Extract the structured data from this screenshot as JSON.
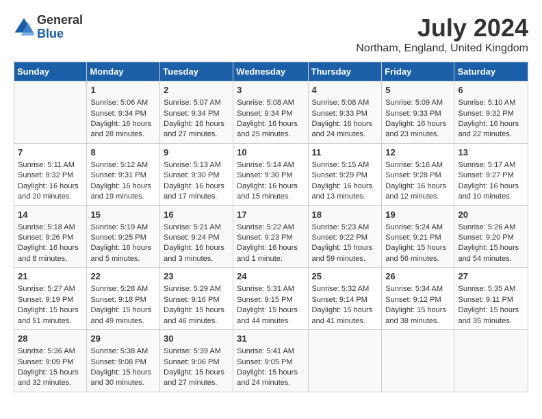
{
  "header": {
    "logo_general": "General",
    "logo_blue": "Blue",
    "month_year": "July 2024",
    "location": "Northam, England, United Kingdom"
  },
  "days_of_week": [
    "Sunday",
    "Monday",
    "Tuesday",
    "Wednesday",
    "Thursday",
    "Friday",
    "Saturday"
  ],
  "weeks": [
    [
      {
        "day": "",
        "info": ""
      },
      {
        "day": "1",
        "info": "Sunrise: 5:06 AM\nSunset: 9:34 PM\nDaylight: 16 hours\nand 28 minutes."
      },
      {
        "day": "2",
        "info": "Sunrise: 5:07 AM\nSunset: 9:34 PM\nDaylight: 16 hours\nand 27 minutes."
      },
      {
        "day": "3",
        "info": "Sunrise: 5:08 AM\nSunset: 9:34 PM\nDaylight: 16 hours\nand 25 minutes."
      },
      {
        "day": "4",
        "info": "Sunrise: 5:08 AM\nSunset: 9:33 PM\nDaylight: 16 hours\nand 24 minutes."
      },
      {
        "day": "5",
        "info": "Sunrise: 5:09 AM\nSunset: 9:33 PM\nDaylight: 16 hours\nand 23 minutes."
      },
      {
        "day": "6",
        "info": "Sunrise: 5:10 AM\nSunset: 9:32 PM\nDaylight: 16 hours\nand 22 minutes."
      }
    ],
    [
      {
        "day": "7",
        "info": "Sunrise: 5:11 AM\nSunset: 9:32 PM\nDaylight: 16 hours\nand 20 minutes."
      },
      {
        "day": "8",
        "info": "Sunrise: 5:12 AM\nSunset: 9:31 PM\nDaylight: 16 hours\nand 19 minutes."
      },
      {
        "day": "9",
        "info": "Sunrise: 5:13 AM\nSunset: 9:30 PM\nDaylight: 16 hours\nand 17 minutes."
      },
      {
        "day": "10",
        "info": "Sunrise: 5:14 AM\nSunset: 9:30 PM\nDaylight: 16 hours\nand 15 minutes."
      },
      {
        "day": "11",
        "info": "Sunrise: 5:15 AM\nSunset: 9:29 PM\nDaylight: 16 hours\nand 13 minutes."
      },
      {
        "day": "12",
        "info": "Sunrise: 5:16 AM\nSunset: 9:28 PM\nDaylight: 16 hours\nand 12 minutes."
      },
      {
        "day": "13",
        "info": "Sunrise: 5:17 AM\nSunset: 9:27 PM\nDaylight: 16 hours\nand 10 minutes."
      }
    ],
    [
      {
        "day": "14",
        "info": "Sunrise: 5:18 AM\nSunset: 9:26 PM\nDaylight: 16 hours\nand 8 minutes."
      },
      {
        "day": "15",
        "info": "Sunrise: 5:19 AM\nSunset: 9:25 PM\nDaylight: 16 hours\nand 5 minutes."
      },
      {
        "day": "16",
        "info": "Sunrise: 5:21 AM\nSunset: 9:24 PM\nDaylight: 16 hours\nand 3 minutes."
      },
      {
        "day": "17",
        "info": "Sunrise: 5:22 AM\nSunset: 9:23 PM\nDaylight: 16 hours\nand 1 minute."
      },
      {
        "day": "18",
        "info": "Sunrise: 5:23 AM\nSunset: 9:22 PM\nDaylight: 15 hours\nand 59 minutes."
      },
      {
        "day": "19",
        "info": "Sunrise: 5:24 AM\nSunset: 9:21 PM\nDaylight: 15 hours\nand 56 minutes."
      },
      {
        "day": "20",
        "info": "Sunrise: 5:26 AM\nSunset: 9:20 PM\nDaylight: 15 hours\nand 54 minutes."
      }
    ],
    [
      {
        "day": "21",
        "info": "Sunrise: 5:27 AM\nSunset: 9:19 PM\nDaylight: 15 hours\nand 51 minutes."
      },
      {
        "day": "22",
        "info": "Sunrise: 5:28 AM\nSunset: 9:18 PM\nDaylight: 15 hours\nand 49 minutes."
      },
      {
        "day": "23",
        "info": "Sunrise: 5:29 AM\nSunset: 9:16 PM\nDaylight: 15 hours\nand 46 minutes."
      },
      {
        "day": "24",
        "info": "Sunrise: 5:31 AM\nSunset: 9:15 PM\nDaylight: 15 hours\nand 44 minutes."
      },
      {
        "day": "25",
        "info": "Sunrise: 5:32 AM\nSunset: 9:14 PM\nDaylight: 15 hours\nand 41 minutes."
      },
      {
        "day": "26",
        "info": "Sunrise: 5:34 AM\nSunset: 9:12 PM\nDaylight: 15 hours\nand 38 minutes."
      },
      {
        "day": "27",
        "info": "Sunrise: 5:35 AM\nSunset: 9:11 PM\nDaylight: 15 hours\nand 35 minutes."
      }
    ],
    [
      {
        "day": "28",
        "info": "Sunrise: 5:36 AM\nSunset: 9:09 PM\nDaylight: 15 hours\nand 32 minutes."
      },
      {
        "day": "29",
        "info": "Sunrise: 5:38 AM\nSunset: 9:08 PM\nDaylight: 15 hours\nand 30 minutes."
      },
      {
        "day": "30",
        "info": "Sunrise: 5:39 AM\nSunset: 9:06 PM\nDaylight: 15 hours\nand 27 minutes."
      },
      {
        "day": "31",
        "info": "Sunrise: 5:41 AM\nSunset: 9:05 PM\nDaylight: 15 hours\nand 24 minutes."
      },
      {
        "day": "",
        "info": ""
      },
      {
        "day": "",
        "info": ""
      },
      {
        "day": "",
        "info": ""
      }
    ]
  ]
}
